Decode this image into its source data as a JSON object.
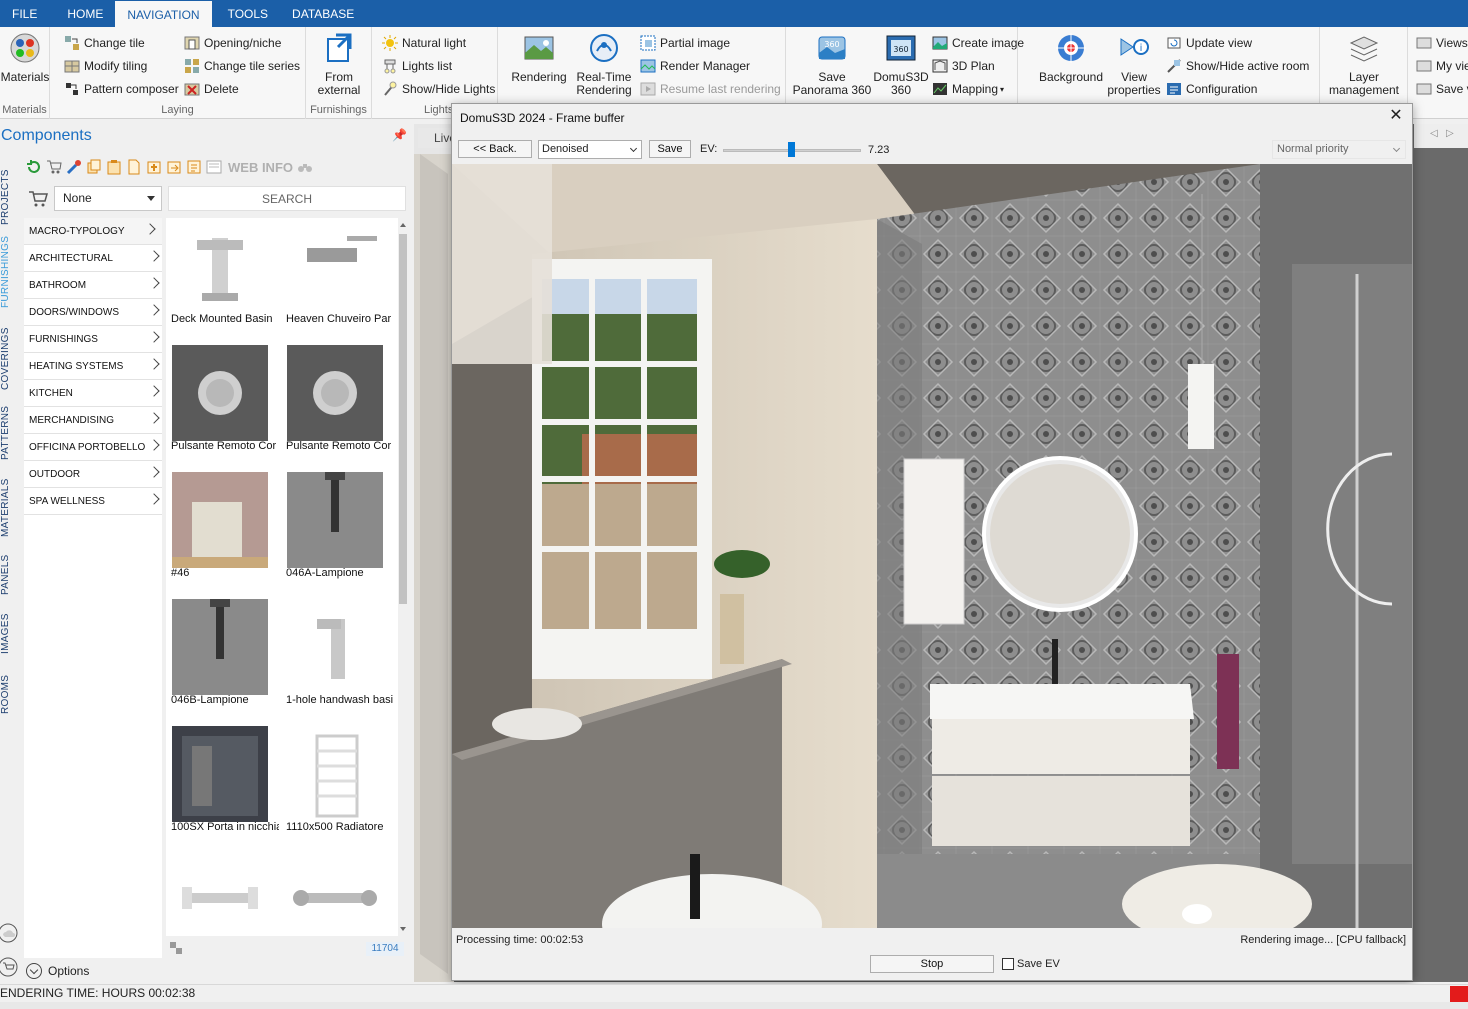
{
  "menu": {
    "tabs": [
      "FILE",
      "HOME",
      "NAVIGATION",
      "TOOLS",
      "DATABASE"
    ],
    "active": "NAVIGATION"
  },
  "ribbon": {
    "materials": {
      "label": "Materials",
      "group": "Materials"
    },
    "laying": {
      "group": "Laying",
      "items": [
        "Change tile",
        "Modify tiling",
        "Pattern composer",
        "Opening/niche",
        "Change tile series",
        "Delete"
      ]
    },
    "furnishings": {
      "label1": "From",
      "label2": "external",
      "group": "Furnishings"
    },
    "lights": {
      "group": "Lights",
      "items": [
        "Natural light",
        "Lights list",
        "Show/Hide Lights"
      ]
    },
    "rendering": {
      "rendering": "Rendering",
      "realtime1": "Real-Time",
      "realtime2": "Rendering",
      "items": [
        "Partial image",
        "Render Manager",
        "Resume last rendering"
      ]
    },
    "save_pano": {
      "l1": "Save",
      "l2": "Panorama 360"
    },
    "domus360": {
      "l1": "DomuS3D",
      "l2": "360"
    },
    "image_items": [
      "Create image",
      "3D Plan",
      "Mapping"
    ],
    "background": "Background",
    "view_props": {
      "l1": "View",
      "l2": "properties"
    },
    "view_items": [
      "Update view",
      "Show/Hide active room",
      "Configuration"
    ],
    "layer": {
      "l1": "Layer",
      "l2": "management"
    },
    "right_items": [
      "Views",
      "My vie",
      "Save v"
    ]
  },
  "components": {
    "title": "Components",
    "webinfo": "WEB INFO",
    "select_value": "None",
    "search_placeholder": "SEARCH",
    "categories": [
      "MACRO-TYPOLOGY",
      "ARCHITECTURAL",
      "BATHROOM",
      "DOORS/WINDOWS",
      "FURNISHINGS",
      "HEATING SYSTEMS",
      "KITCHEN",
      "MERCHANDISING",
      "OFFICINA PORTOBELLO",
      "OUTDOOR",
      "SPA WELLNESS"
    ],
    "items": [
      "Deck Mounted Basin",
      "Heaven Chuveiro Par",
      "Pulsante Remoto Cor",
      "Pulsante Remoto Cor",
      "#46",
      "046A-Lampione",
      "046B-Lampione",
      "1-hole handwash basi",
      "100SX Porta in nicchia",
      "1110x500 Radiatore"
    ],
    "count": "11704",
    "options": "Options"
  },
  "vtabs": [
    "PROJECTS",
    "FURNISHINGS",
    "COVERINGS",
    "PATTERNS",
    "MATERIALS",
    "PANELS",
    "IMAGES",
    "ROOMS"
  ],
  "viewport": {
    "tab": "Live"
  },
  "dialog": {
    "title": "DomuS3D 2024 - Frame buffer",
    "back": "<< Back.",
    "mode": "Denoised",
    "save": "Save",
    "ev_label": "EV:",
    "ev_value": "7.23",
    "priority": "Normal priority",
    "processing": "Processing time: 00:02:53",
    "status": "Rendering image... [CPU fallback]",
    "stop": "Stop",
    "save_ev": "Save EV"
  },
  "statusbar": {
    "text": "ENDERING TIME: HOURS 00:02:38"
  }
}
